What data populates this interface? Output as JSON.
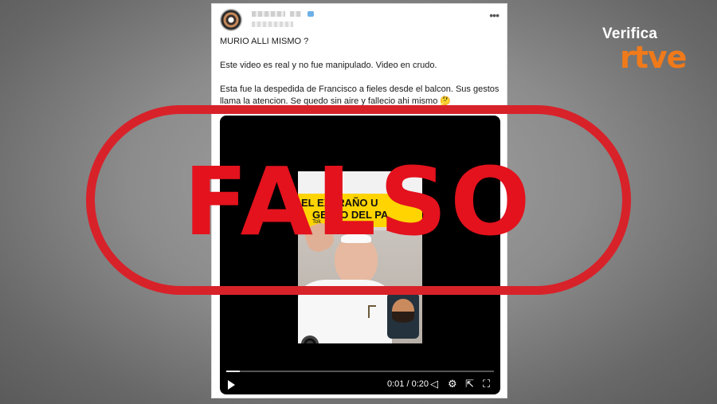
{
  "brand": {
    "top": "Verifica",
    "bottom": "rtve",
    "accent": "#f07a1a"
  },
  "post": {
    "text": [
      "MURIO ALLI MISMO ?",
      "Este video es real y no fue manipulado. Video en crudo.",
      "Esta fue la despedida de Francisco a fieles desde el balcon. Sus gestos llama la atencion. Se quedo sin aire y fallecio ahi mismo 🤔"
    ],
    "more_icon": "more-horizontal-icon"
  },
  "video": {
    "banner_line1": "EL EXTRAÑO U",
    "banner_line2": "GESTO DEL PA",
    "tag": "Tok",
    "time": "0:01 / 0:20",
    "progress": 0.05,
    "icons": [
      "play-icon",
      "volume-icon",
      "settings-icon",
      "share-icon",
      "fullscreen-icon"
    ]
  },
  "stamp": {
    "label": "FALSO",
    "color": "#d8222a"
  }
}
